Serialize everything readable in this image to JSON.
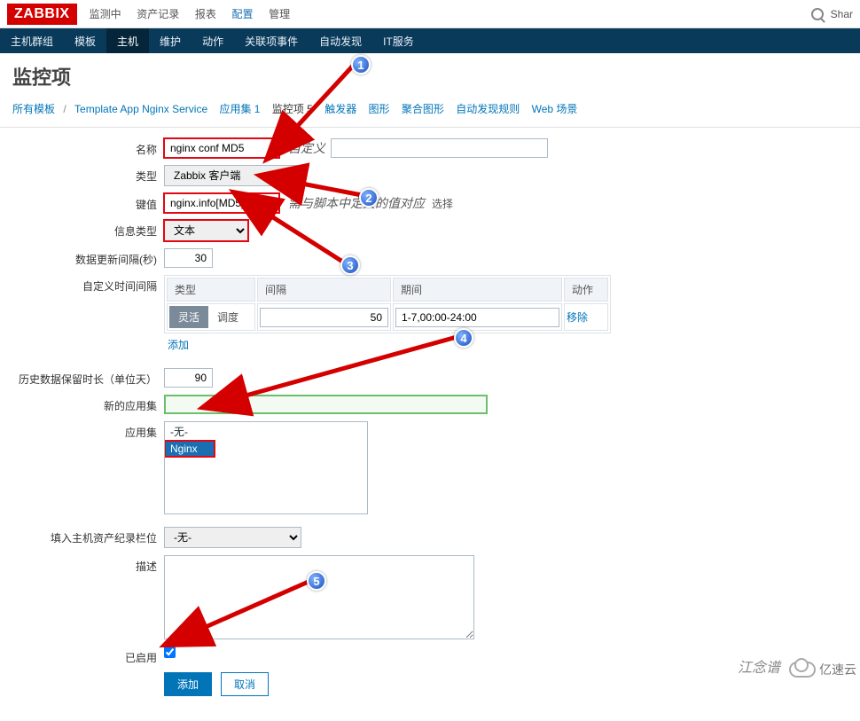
{
  "logo": "ZABBIX",
  "topNav": [
    "监测中",
    "资产记录",
    "报表",
    "配置",
    "管理"
  ],
  "topNavActive": 3,
  "share": "Shar",
  "subNav": [
    "主机群组",
    "模板",
    "主机",
    "维护",
    "动作",
    "关联项事件",
    "自动发现",
    "IT服务"
  ],
  "subNavActive": 2,
  "pageTitle": "监控项",
  "breadcrumb": {
    "allTemplates": "所有模板",
    "template": "Template App Nginx Service",
    "appsets": "应用集 1",
    "items": "监控项 5",
    "triggers": "触发器",
    "graphs": "图形",
    "aggGraphs": "聚合图形",
    "discovery": "自动发现规则",
    "web": "Web 场景"
  },
  "form": {
    "labels": {
      "name": "名称",
      "type": "类型",
      "key": "键值",
      "infoType": "信息类型",
      "updateInterval": "数据更新间隔(秒)",
      "customInterval": "自定义时间间隔",
      "history": "历史数据保留时长（单位天）",
      "newApp": "新的应用集",
      "appset": "应用集",
      "asset": "填入主机资产纪录栏位",
      "desc": "描述",
      "enabled": "已启用"
    },
    "name": "nginx conf MD5",
    "nameNote": "自定义",
    "type": "Zabbix 客户端",
    "key": "nginx.info[MD5]",
    "keyNote": "需与脚本中定义的值对应",
    "keySelect": "选择",
    "infoType": "文本",
    "updateInterval": "30",
    "intervalHeaders": {
      "type": "类型",
      "interval": "间隔",
      "period": "期间",
      "action": "动作"
    },
    "tabFlexible": "灵活",
    "tabScheduled": "调度",
    "intervalVal": "50",
    "periodVal": "1-7,00:00-24:00",
    "remove": "移除",
    "addInterval": "添加",
    "history": "90",
    "newApp": "",
    "appOptions": [
      "-无-",
      "Nginx"
    ],
    "appSelected": 1,
    "asset": "-无-",
    "desc": "",
    "enabled": true,
    "submit": "添加",
    "cancel": "取消"
  },
  "callouts": {
    "1": "1",
    "2": "2",
    "3": "3",
    "4": "4",
    "5": "5"
  },
  "watermark1": "江念谱",
  "watermark2": "亿速云"
}
